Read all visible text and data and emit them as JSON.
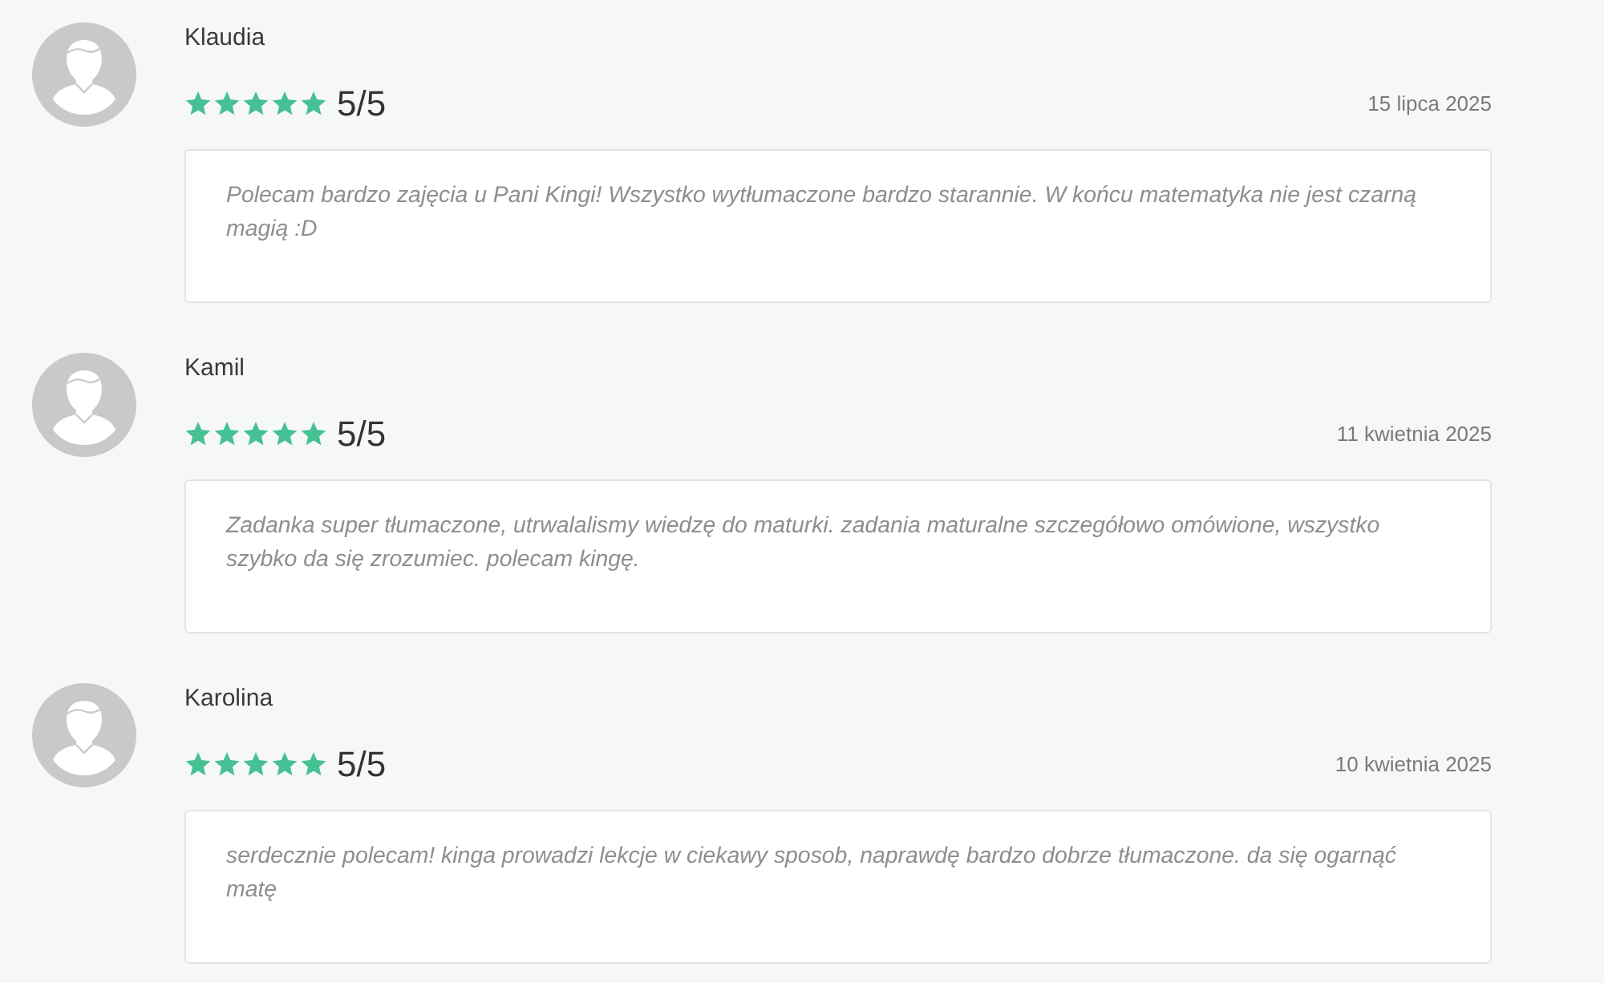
{
  "reviews": [
    {
      "name": "Klaudia",
      "stars": 5,
      "score": "5/5",
      "date": "15 lipca 2025",
      "comment": "Polecam bardzo zajęcia u Pani Kingi! Wszystko wytłumaczone bardzo starannie. W końcu matematyka nie jest czarną magią :D"
    },
    {
      "name": "Kamil",
      "stars": 5,
      "score": "5/5",
      "date": "11 kwietnia 2025",
      "comment": "Zadanka super tłumaczone, utrwalalismy wiedzę do maturki. zadania maturalne szczegółowo omówione, wszystko szybko da się zrozumiec. polecam kingę."
    },
    {
      "name": "Karolina",
      "stars": 5,
      "score": "5/5",
      "date": "10 kwietnia 2025",
      "comment": "serdecznie polecam! kinga prowadzi lekcje w ciekawy sposob, naprawdę bardzo dobrze tłumaczone. da się ogarnąć matę"
    }
  ]
}
